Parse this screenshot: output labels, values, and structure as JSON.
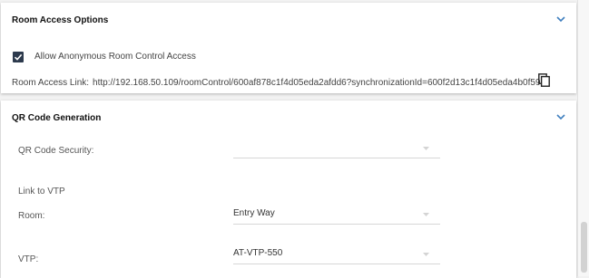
{
  "access_panel": {
    "title": "Room Access Options",
    "allow_anonymous": {
      "label": "Allow Anonymous Room Control Access",
      "checked": true
    },
    "room_link": {
      "label": "Room Access Link:",
      "value": "http://192.168.50.109/roomControl/600af878c1f4d05eda2afdd6?synchronizationId=600f2d13c1f4d05eda4b0f59",
      "copy_icon": "copy-icon"
    },
    "expand_icon": "chevron-down-icon"
  },
  "qr_panel": {
    "title": "QR Code Generation",
    "expand_icon": "chevron-down-icon",
    "qr_security": {
      "label": "QR Code Security:",
      "value": ""
    },
    "link_to_vtp": {
      "heading": "Link to VTP",
      "room": {
        "label": "Room:",
        "value": "Entry Way"
      },
      "vtp": {
        "label": "VTP:",
        "value": "AT-VTP-550"
      }
    }
  },
  "colors": {
    "accent": "#3f7fbf",
    "checkbox": "#2d3a4d",
    "panel_bg": "#ffffff",
    "page_bg": "#f2f2f2"
  }
}
